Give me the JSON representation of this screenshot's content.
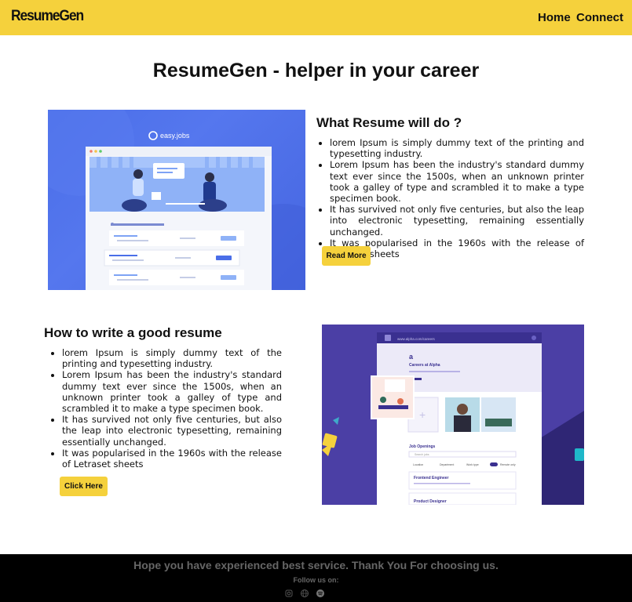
{
  "brand": {
    "logo_text": "ResumeGen"
  },
  "nav": {
    "items": [
      {
        "label": "Home"
      },
      {
        "label": "Connect"
      }
    ]
  },
  "page": {
    "title": "ResumeGen - helper in your career"
  },
  "section1": {
    "title": "What Resume will do ?",
    "bullets": [
      "lorem Ipsum is simply dummy text of the printing and typesetting industry.",
      " Lorem Ipsum has been the industry's standard dummy text ever since the 1500s, when an unknown printer took a galley of type and scrambled it to make a type specimen book.",
      "It has survived not only five centuries, but also the leap into electronic typesetting, remaining essentially unchanged.",
      "It was popularised in the 1960s with the release of Letraset sheets"
    ],
    "button_label": "Read More",
    "image": {
      "brand_text": "easy.jobs"
    }
  },
  "section2": {
    "title": "How to write a good resume",
    "bullets": [
      "lorem Ipsum is simply dummy text of the printing and typesetting industry.",
      " Lorem Ipsum has been the industry's standard dummy text ever since the 1500s, when an unknown printer took a galley of type and scrambled it to make a type specimen book.",
      "It has survived not only five centuries, but also the leap into electronic typesetting, remaining essentially unchanged.",
      "It was popularised in the 1960s with the release of Letraset sheets"
    ],
    "button_label": "Click Here",
    "image": {
      "url_text": "www.alpha.com/careers",
      "company_heading": "Careers at Alpha",
      "job_openings_label": "Job Openings",
      "search_placeholder": "Search jobs",
      "filters": [
        "Location",
        "Department",
        "Work type",
        "Remote only"
      ],
      "jobs": [
        "Frontend Engineer",
        "Product Designer"
      ]
    }
  },
  "footer": {
    "message": "Hope you have experienced best service. Thank You For choosing us.",
    "follow_label": "Follow us on:",
    "social_icons": [
      "instagram-icon",
      "globe-icon",
      "spotify-icon"
    ]
  },
  "colors": {
    "accent": "#f5d13c",
    "footer_bg": "#000000",
    "footer_text": "#666666"
  }
}
